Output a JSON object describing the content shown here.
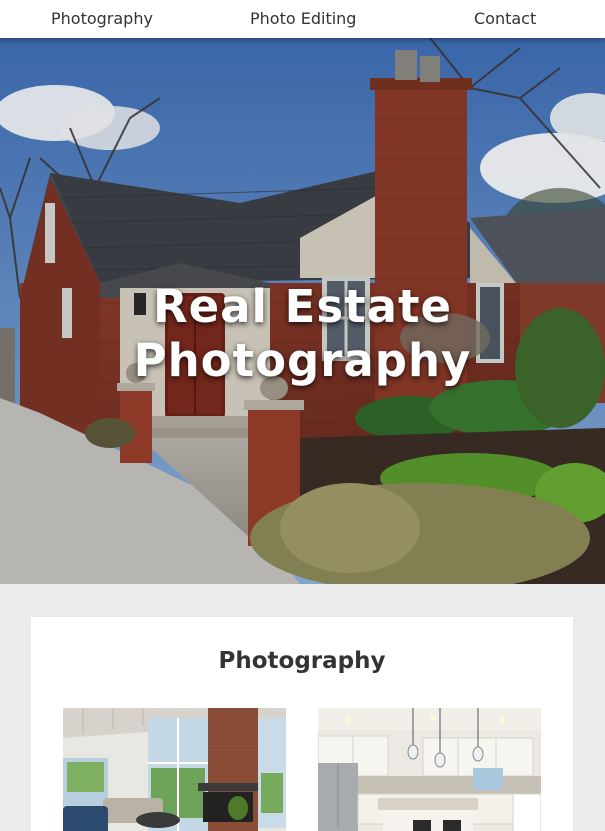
{
  "nav": {
    "items": [
      {
        "label": "Photography"
      },
      {
        "label": "Photo Editing"
      },
      {
        "label": "Contact"
      }
    ]
  },
  "hero": {
    "title_line1": "Real Estate",
    "title_line2": "Photography"
  },
  "section": {
    "title": "Photography"
  },
  "colors": {
    "nav_bg": "#ffffff",
    "page_bg": "#ebebeb",
    "text": "#333333",
    "hero_text": "#ffffff"
  }
}
